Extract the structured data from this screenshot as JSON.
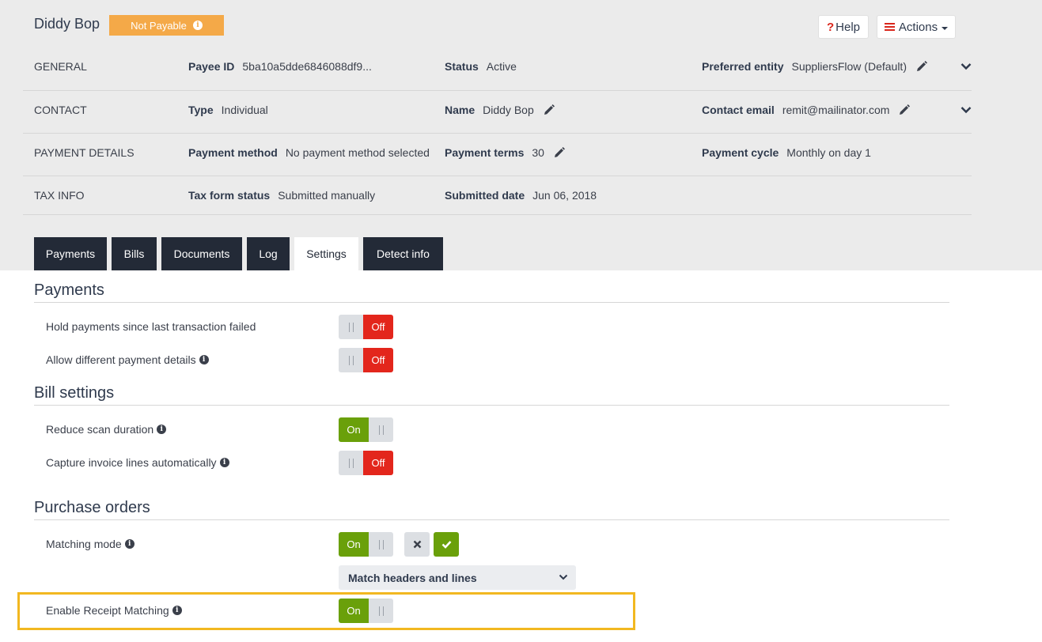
{
  "header": {
    "payee_name": "Diddy Bop",
    "status_badge": "Not Payable",
    "help_label": "Help",
    "help_symbol": "?",
    "actions_label": "Actions"
  },
  "info_rows": {
    "general": {
      "category": "GENERAL",
      "payee_id_label": "Payee ID",
      "payee_id_value": "5ba10a5dde6846088df9...",
      "status_label": "Status",
      "status_value": "Active",
      "entity_label": "Preferred entity",
      "entity_value": "SuppliersFlow (Default)"
    },
    "contact": {
      "category": "CONTACT",
      "type_label": "Type",
      "type_value": "Individual",
      "name_label": "Name",
      "name_value": "Diddy Bop",
      "email_label": "Contact email",
      "email_value": "remit@mailinator.com"
    },
    "payment_details": {
      "category": "PAYMENT DETAILS",
      "method_label": "Payment method",
      "method_value": "No payment method selected",
      "terms_label": "Payment terms",
      "terms_value": "30",
      "cycle_label": "Payment cycle",
      "cycle_value": "Monthly on day 1"
    },
    "tax_info": {
      "category": "TAX INFO",
      "form_label": "Tax form status",
      "form_value": "Submitted manually",
      "date_label": "Submitted date",
      "date_value": "Jun 06, 2018"
    }
  },
  "tabs": [
    "Payments",
    "Bills",
    "Documents",
    "Log",
    "Settings",
    "Detect info"
  ],
  "active_tab": "Settings",
  "settings": {
    "payments": {
      "title": "Payments",
      "hold_label": "Hold payments since last transaction failed",
      "hold_state": "Off",
      "allow_label": "Allow different payment details",
      "allow_state": "Off"
    },
    "bills": {
      "title": "Bill settings",
      "reduce_label": "Reduce scan duration",
      "reduce_state": "On",
      "capture_label": "Capture invoice lines automatically",
      "capture_state": "Off"
    },
    "purchase_orders": {
      "title": "Purchase orders",
      "matching_label": "Matching mode",
      "matching_state": "On",
      "matching_select_value": "Match headers and lines",
      "receipt_label": "Enable Receipt Matching",
      "receipt_state": "On"
    }
  },
  "colors": {
    "badge": "#f4a948",
    "toggle_on": "#6aa00a",
    "toggle_off": "#e3261c",
    "tab_dark": "#232a37",
    "highlight": "#f2b820"
  }
}
